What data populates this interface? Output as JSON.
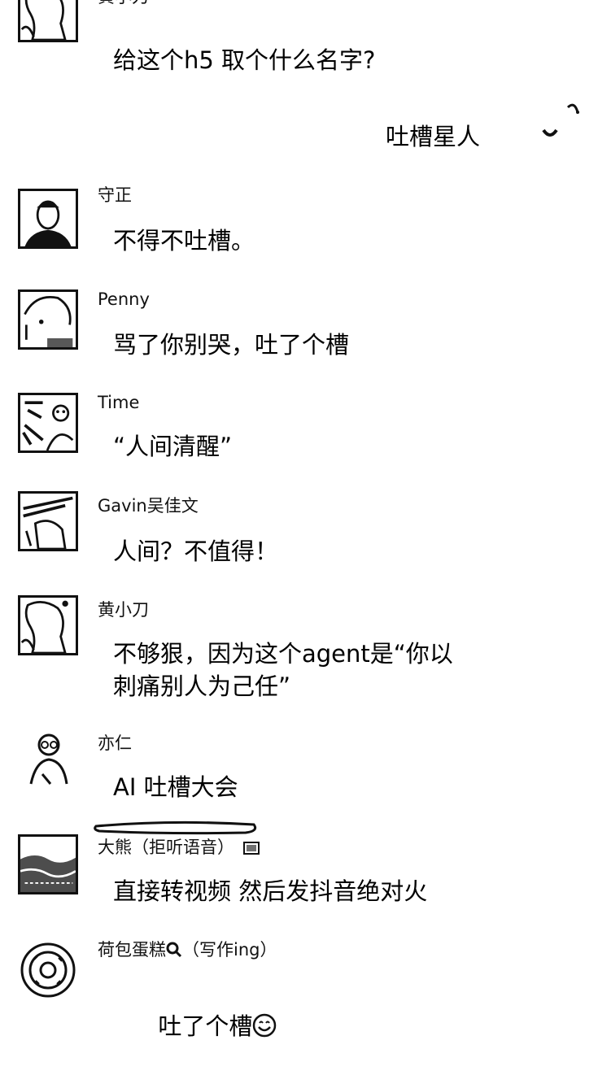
{
  "messages": [
    {
      "sender": "黄小刀",
      "text": "给这个h5 取个什么名字?"
    },
    {
      "self": true,
      "text": "吐槽星人"
    },
    {
      "sender": "守正",
      "text": "不得不吐槽。"
    },
    {
      "sender": "Penny",
      "text": "骂了你别哭，吐了个槽"
    },
    {
      "sender": "Time",
      "text": "“人间清醒”"
    },
    {
      "sender": "Gavin吴佳文",
      "text": "人间？不值得！"
    },
    {
      "sender": "黄小刀",
      "text": "不够狠，因为这个agent是“你以\n刺痛别人为己任”"
    },
    {
      "sender": "亦仁",
      "text": "AI 吐槽大会"
    },
    {
      "sender": "大熊（拒听语音）",
      "text": "直接转视频 然后发抖音绝对火"
    },
    {
      "sender_prefix": "荷包蛋糕",
      "sender_suffix": "（写作ing）",
      "text": "吐了个槽"
    }
  ]
}
